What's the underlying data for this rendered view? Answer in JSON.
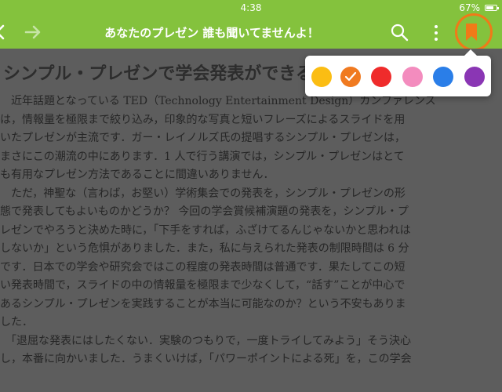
{
  "status_bar": {
    "time": "4:38",
    "battery": "67%"
  },
  "nav": {
    "title": "あなたのプレゼン 誰も聞いてませんよ！",
    "icons": [
      "back-arrow-icon",
      "forward-arrow-icon",
      "search-icon",
      "more-vertical-icon",
      "bookmark-icon"
    ]
  },
  "document": {
    "heading": "シンプル・プレゼンで学会発表ができるの",
    "lines": [
      "　近年話題となっている TED（Technology Entertainment Design）カンファレンス",
      "は，情報量を極限まで絞り込み，印象的な写真と短いフレーズによるスライドを用",
      "いたプレゼンが主流です．ガー・レイノルズ氏の提唱するシンプル・プレゼンは，",
      "まさにこの潮流の中にあります．1 人で行う講演では，シンプル・プレゼンはとて",
      "も有用なプレゼン方法であることに間違いありません．",
      "　ただ，神聖な（言わば，お堅い）学術集会での発表を，シンプル・プレゼンの形",
      "態で発表してもよいものかどうか？ 今回の学会賞候補演題の発表を，シンプル・プ",
      "レゼンでやろうと決めた時に，「下手をすれば，ふざけてるんじゃないかと思われは",
      "しないか」という危惧がありました．また，私に与えられた発表の制限時間は 6 分",
      "です．日本での学会や研究会ではこの程度の発表時間は普通です．果たしてこの短",
      "い発表時間で，スライドの中の情報量を極限まで少なくして，“話す”ことが中心で",
      "あるシンプル・プレゼンを実践することが本当に可能なのか？という不安もありま",
      "した．",
      "　「退屈な発表にはしたくない．実験のつもりで，一度トライしてみよう」そう決心",
      "し，本番に向かいました．うまくいけば，「パワーポイントによる死」を，この学会"
    ]
  },
  "highlight_popover": {
    "colors": [
      {
        "name": "yellow",
        "hex": "#fbbd13",
        "selected": false
      },
      {
        "name": "orange",
        "hex": "#f07a20",
        "selected": true
      },
      {
        "name": "red",
        "hex": "#ef2b2b",
        "selected": false
      },
      {
        "name": "pink",
        "hex": "#f38cbe",
        "selected": false
      },
      {
        "name": "blue",
        "hex": "#2a7ee8",
        "selected": false
      },
      {
        "name": "purple",
        "hex": "#8a36b4",
        "selected": false
      }
    ]
  },
  "theme": {
    "toolbar": "#84c23d",
    "bookmark_accent": "#f07a18"
  }
}
